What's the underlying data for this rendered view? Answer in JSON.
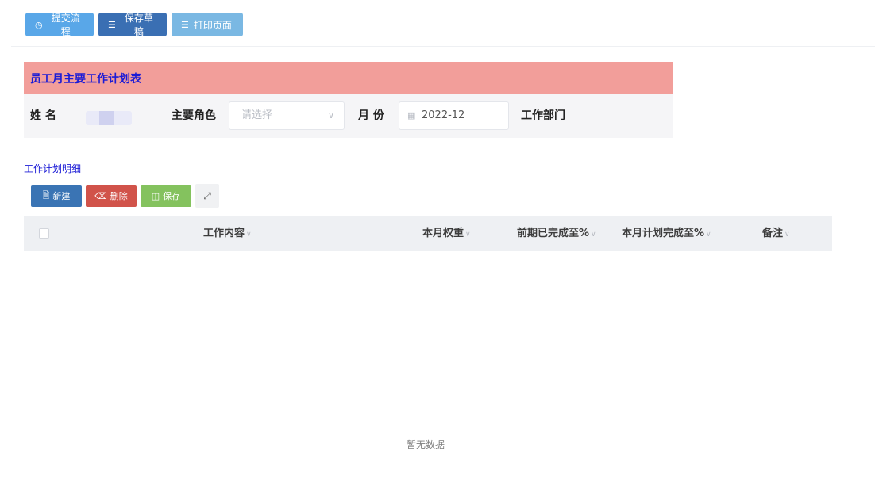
{
  "toolbar": {
    "submit_label": "提交流程",
    "save_draft_label": "保存草稿",
    "print_label": "打印页面"
  },
  "form": {
    "title": "员工月主要工作计划表",
    "name_label": "姓 名",
    "role_label": "主要角色",
    "role_placeholder": "请选择",
    "month_label": "月 份",
    "month_value": "2022-12",
    "dept_label": "工作部门"
  },
  "detail": {
    "title": "工作计划明细",
    "new_label": "新建",
    "delete_label": "删除",
    "save_label": "保存",
    "columns": [
      "工作内容",
      "本月权重",
      "前期已完成至%",
      "本月计划完成至%",
      "备注"
    ],
    "empty_text": "暂无数据"
  },
  "colors": {
    "title_bar": "#f29e9a",
    "title_text": "#1b1bd6",
    "new_button": "#3a74b4",
    "delete_button": "#d1534a",
    "save_button": "#84c25e"
  },
  "icons": {
    "submit": "clock-icon",
    "draft": "list-icon",
    "print": "list-icon",
    "new": "file-icon",
    "delete": "trash-icon",
    "save": "floppy-icon",
    "expand": "expand-icon",
    "select": "chevron-down-icon",
    "date": "calendar-icon",
    "sort": "sort-icon"
  }
}
